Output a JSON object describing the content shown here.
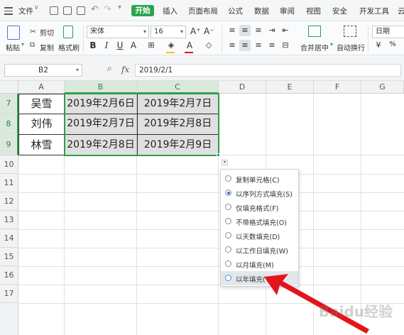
{
  "menubar": {
    "file_label": "文件",
    "start_label": "开始",
    "tabs": [
      "插入",
      "页面布局",
      "公式",
      "数据",
      "审阅",
      "视图",
      "安全",
      "开发工具",
      "云"
    ]
  },
  "ribbon": {
    "paste": "粘贴",
    "cut": "剪切",
    "copy": "复制",
    "format_painter": "格式刷",
    "font_name": "宋体",
    "font_size": "16",
    "merge_center": "合并居中",
    "auto_wrap": "自动换行",
    "number_format": "日期"
  },
  "formula_bar": {
    "name_box": "B2",
    "fx": "fx",
    "value": "2019/2/1"
  },
  "grid": {
    "columns": [
      "A",
      "B",
      "C",
      "D",
      "E",
      "F",
      "G"
    ],
    "rows": [
      "7",
      "8",
      "9",
      "10",
      "11",
      "12",
      "13",
      "14",
      "15",
      "16",
      "17"
    ],
    "data": [
      {
        "a": "吴雪",
        "b": "2019年2月6日",
        "c": "2019年2月7日"
      },
      {
        "a": "刘伟",
        "b": "2019年2月7日",
        "c": "2019年2月8日"
      },
      {
        "a": "林雪",
        "b": "2019年2月8日",
        "c": "2019年2月9日"
      }
    ]
  },
  "fill_menu": {
    "options": [
      {
        "label": "复制单元格(C)",
        "selected": false
      },
      {
        "label": "以序列方式填充(S)",
        "selected": true
      },
      {
        "label": "仅填充格式(F)",
        "selected": false
      },
      {
        "label": "不带格式填充(O)",
        "selected": false
      },
      {
        "label": "以天数填充(D)",
        "selected": false
      },
      {
        "label": "以工作日填充(W)",
        "selected": false
      },
      {
        "label": "以月填充(M)",
        "selected": false
      },
      {
        "label": "以年填充(Y)",
        "selected": false
      }
    ]
  },
  "colors": {
    "accent_green": "#2aa44f",
    "selection_border": "#2f9e4a",
    "arrow_red": "#e3141b"
  },
  "watermark": "Baidu经验"
}
